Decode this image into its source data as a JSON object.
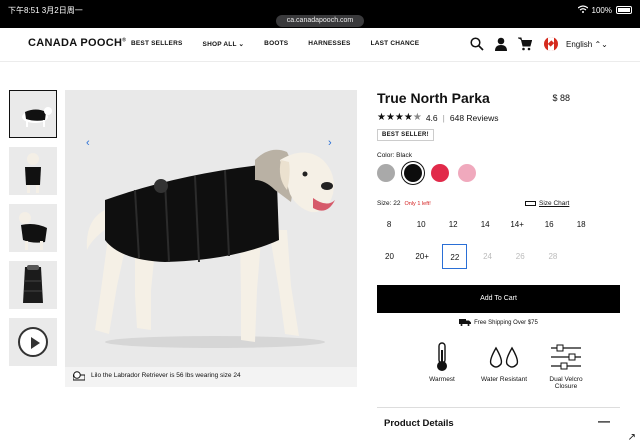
{
  "statusbar": {
    "time": "下午8:51  3月2日周一",
    "url": "ca.canadapooch.com",
    "battery": "100%"
  },
  "nav": {
    "logo": "CANADA POOCH",
    "logo_mark": "®",
    "items": [
      {
        "label": "BEST SELLERS"
      },
      {
        "label": "SHOP ALL ⌄"
      },
      {
        "label": "BOOTS"
      },
      {
        "label": "HARNESSES"
      },
      {
        "label": "LAST CHANCE"
      }
    ],
    "language": "English ⌃⌄"
  },
  "gallery": {
    "caption": "Lilo the Labrador Retriever is 56 lbs wearing size 24",
    "prev": "‹",
    "next": "›"
  },
  "product": {
    "title": "True North Parka",
    "price": "$ 88",
    "rating": "4.6",
    "reviews": "648 Reviews",
    "badge": "BEST SELLER!",
    "color_label": "Color: Black",
    "swatches": [
      "#a9a9a9",
      "#0d0d0d",
      "#e12a4a",
      "#f0a9bd"
    ],
    "size_label": "Size: 22",
    "size_note": "Only 1 left!",
    "size_chart": "Size Chart",
    "sizes_row1": [
      "8",
      "10",
      "12",
      "14",
      "14+",
      "16",
      "18"
    ],
    "sizes_row2": [
      "20",
      "20+",
      "22",
      "24",
      "26",
      "28"
    ],
    "add_to_cart": "Add To Cart",
    "shipping": "Free Shipping Over $75",
    "features": [
      {
        "label": "Warmest",
        "icon": "thermometer-icon"
      },
      {
        "label": "Water Resistant",
        "icon": "water-drops-icon"
      },
      {
        "label": "Dual Velcro Closure",
        "icon": "sliders-icon"
      }
    ],
    "details_heading": "Product Details",
    "details_toggle": "—"
  }
}
